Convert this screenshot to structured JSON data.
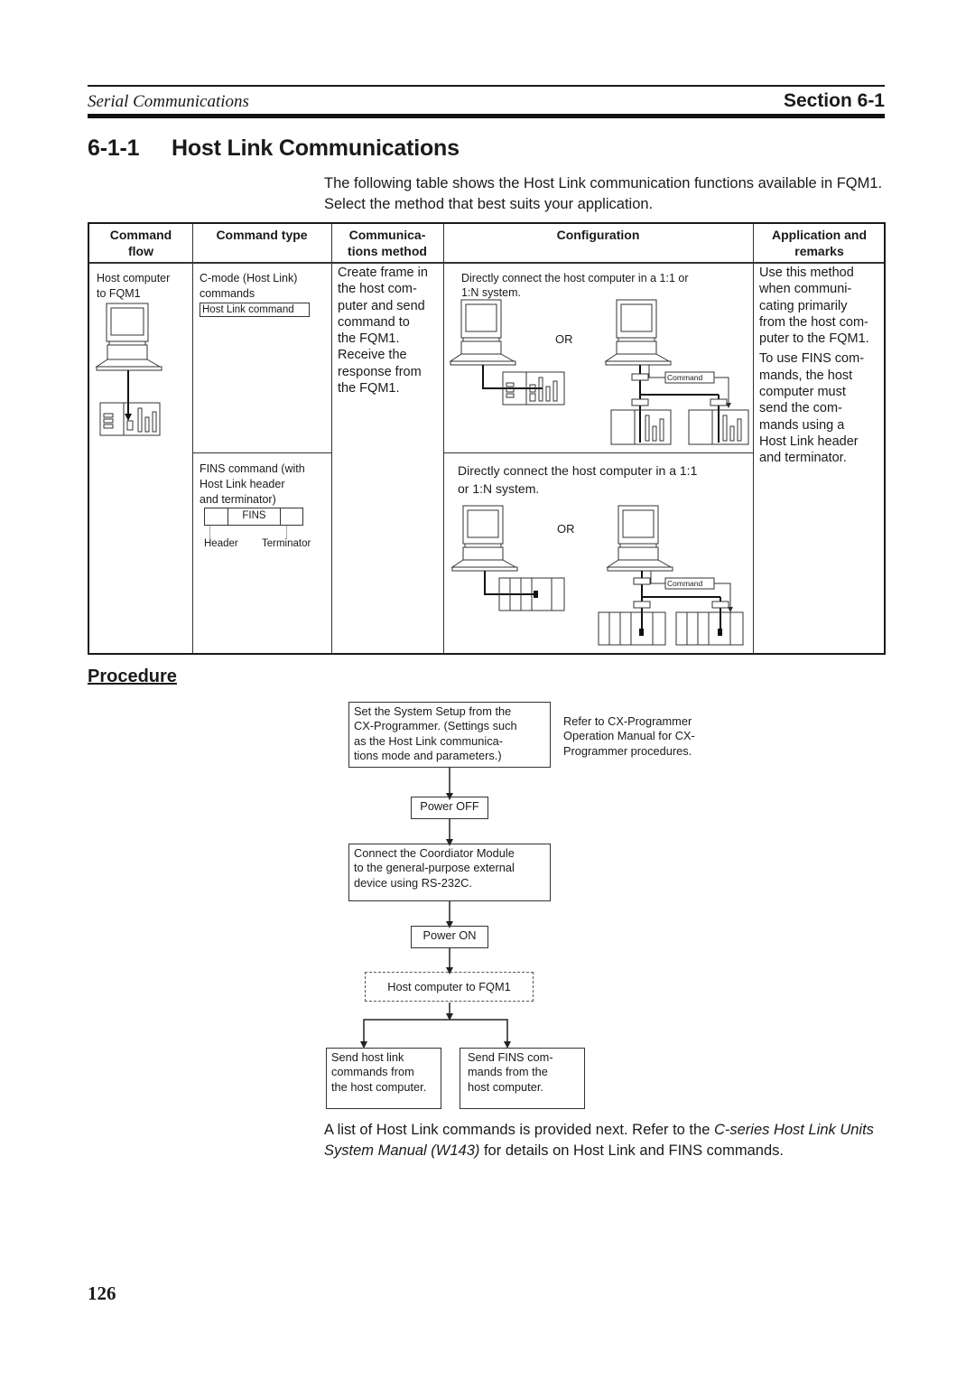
{
  "header": {
    "chapter": "Serial Communications",
    "section": "Section 6-1"
  },
  "title": {
    "number": "6-1-1",
    "text": "Host Link Communications"
  },
  "intro": "The following table shows the Host Link communication functions available in FQM1. Select the method that best suits your application.",
  "table": {
    "headers": {
      "flow": "Command flow",
      "type": "Command type",
      "method": "Communica-tions method",
      "config": "Configuration",
      "remarks": "Application and remarks"
    },
    "header_lines": {
      "flow": [
        "Command",
        "flow"
      ],
      "method": [
        "Communica-",
        "tions method"
      ],
      "remarks": [
        "Application and",
        "remarks"
      ]
    },
    "flow_text": [
      "Host computer",
      "to FQM1"
    ],
    "rows": [
      {
        "type_lines": [
          "C-mode (Host Link)",
          "commands"
        ],
        "type_box": "Host Link command",
        "config_lines": [
          "Directly connect the host computer in a 1:1 or",
          "1:N system."
        ],
        "or_label": "OR",
        "command_label": "Command"
      },
      {
        "type_lines": [
          "FINS command (with",
          "Host Link header",
          "and terminator)"
        ],
        "type_box": "FINS",
        "header_label": "Header",
        "terminator_label": "Terminator",
        "config_lines": [
          "Directly connect the host computer in a 1:1",
          "or 1:N system."
        ],
        "or_label": "OR",
        "command_label": "Command"
      }
    ],
    "method_lines": [
      "Create frame in",
      "the host com-",
      "puter and send",
      "command to",
      "the FQM1.",
      "Receive the",
      "response from",
      "the FQM1."
    ],
    "remarks_lines_1": [
      "Use this method",
      "when communi-",
      "cating primarily",
      "from the host com-",
      "puter to the FQM1."
    ],
    "remarks_lines_2": [
      "To use FINS com-",
      "mands, the host",
      "computer must",
      "send the com-",
      "mands using a",
      "Host Link header",
      "and terminator."
    ]
  },
  "procedure": {
    "heading": "Procedure",
    "step1": [
      "Set the System Setup from the",
      "CX-Programmer. (Settings such",
      "as the Host Link communica-",
      "tions mode and parameters.)"
    ],
    "step1_note": [
      "Refer to CX-Programmer",
      "Operation Manual for CX-",
      "Programmer procedures."
    ],
    "step2": "Power OFF",
    "step3": [
      "Connect the Coordiator Module",
      "to the general-purpose external",
      "device using RS-232C."
    ],
    "step4": "Power ON",
    "step5": "Host computer to FQM1",
    "branch_left": [
      "Send host link",
      "commands from",
      "the host computer."
    ],
    "branch_right": [
      "Send FINS com-",
      "mands from the",
      "host computer."
    ]
  },
  "outro": {
    "part1": "A list of Host Link commands is provided next. Refer to the ",
    "italic1": "C-series Host Link",
    "italic2": "Units System Manual (W143)",
    "part2": " for details on Host Link and FINS commands."
  },
  "page_number": "126"
}
